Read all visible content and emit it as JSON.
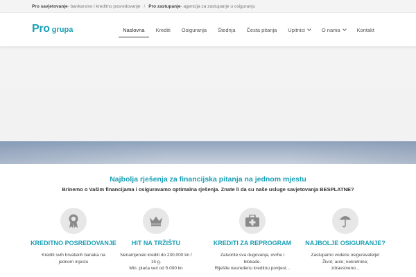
{
  "topbar": {
    "item1_strong": "Pro savjetovanje",
    "item1_text": " - bankarstvo i kreditno posredovanje",
    "separator": "/",
    "item2_strong": "Pro zastupanje",
    "item2_text": " - agencija za zastupanje u osiguranju"
  },
  "logo": {
    "pro": "Pro",
    "grupa": "grupa"
  },
  "nav": {
    "items": [
      {
        "label": "Naslovna"
      },
      {
        "label": "Krediti"
      },
      {
        "label": "Osiguranja"
      },
      {
        "label": "Štednja"
      },
      {
        "label": "Česta pitanja"
      },
      {
        "label": "Upitnici"
      },
      {
        "label": "O nama"
      },
      {
        "label": "Kontakt"
      }
    ]
  },
  "intro": {
    "headline": "Najbolja rješenja za financijska pitanja na jednom mjestu",
    "subline": "Brinemo o Vašim financijama i osiguravamo optimalna rješenja. Znate li da su naše usluge savjetovanja BESPLATNE?"
  },
  "features": [
    {
      "icon": "award-ribbon-icon",
      "title": "KREDITNO POSREDOVANJE",
      "line1": "Krediti svih hrvatskih banaka na",
      "line2": "jednom mjestu",
      "line3": ""
    },
    {
      "icon": "crown-icon",
      "title": "HIT NA TRŽIŠTU",
      "line1": "Nenamjenski krediti do 230.000 kn /",
      "line2": "15 g.",
      "line3": "Min. plaća već od 5.000 kn"
    },
    {
      "icon": "first-aid-kit-icon",
      "title": "KREDITI ZA REPROGRAM",
      "line1": "Zatvorite sva dugovanja, ovrhe i",
      "line2": "blokade.",
      "line3": "Riješite neuredenu kreditnu povijest..."
    },
    {
      "icon": "umbrella-icon",
      "title": "NAJBOLJE OSIGURANJE?",
      "line1": "Zastupamo vodeće osiguravatelje!",
      "line2": "Život; auto; nekretnine;",
      "line3": "zdravstveno..."
    }
  ],
  "colors": {
    "accent": "#1a9fb5",
    "icon_bg": "#e7e7e7",
    "icon_fg": "#8a8a8a"
  }
}
